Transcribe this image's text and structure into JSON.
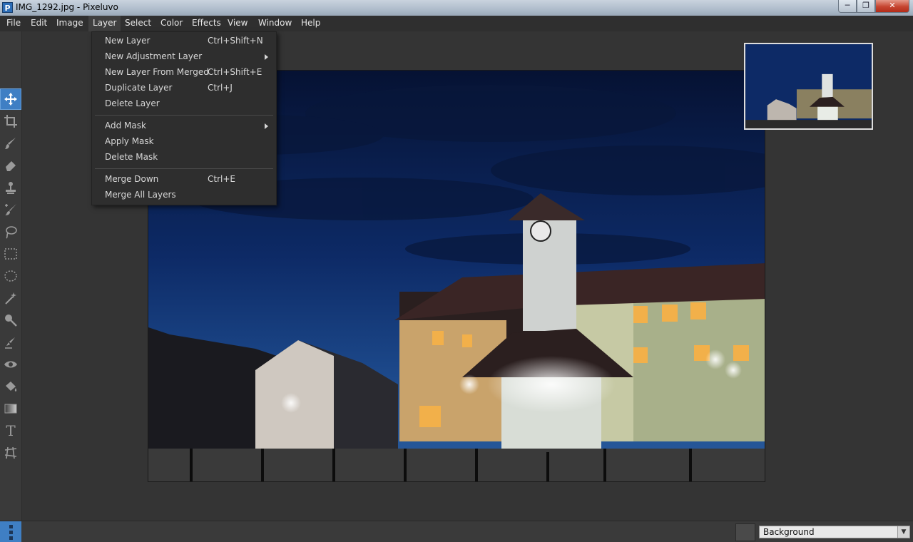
{
  "window": {
    "title": "IMG_1292.jpg - Pixeluvo",
    "app_icon_letter": "P"
  },
  "window_controls": {
    "minimize": "─",
    "maximize": "❐",
    "close": "✕"
  },
  "menubar": {
    "items": [
      {
        "label": "File"
      },
      {
        "label": "Edit"
      },
      {
        "label": "Image"
      },
      {
        "label": "Layer"
      },
      {
        "label": "Select"
      },
      {
        "label": "Color"
      },
      {
        "label": "Effects"
      },
      {
        "label": "View"
      },
      {
        "label": "Window"
      },
      {
        "label": "Help"
      }
    ]
  },
  "layer_menu": {
    "items": [
      {
        "label": "New Layer",
        "shortcut": "Ctrl+Shift+N"
      },
      {
        "label": "New Adjustment Layer",
        "shortcut": "",
        "submenu": true
      },
      {
        "label": "New Layer From Merged",
        "shortcut": "Ctrl+Shift+E"
      },
      {
        "label": "Duplicate Layer",
        "shortcut": "Ctrl+J"
      },
      {
        "label": "Delete Layer",
        "shortcut": ""
      },
      {
        "label": "Add Mask",
        "shortcut": "",
        "submenu": true
      },
      {
        "label": "Apply Mask",
        "shortcut": ""
      },
      {
        "label": "Delete Mask",
        "shortcut": ""
      },
      {
        "label": "Merge Down",
        "shortcut": "Ctrl+E"
      },
      {
        "label": "Merge All Layers",
        "shortcut": ""
      }
    ]
  },
  "toolbar": {
    "tools": [
      "move-icon",
      "crop-icon",
      "brush-icon",
      "eraser-icon",
      "clone-stamp-icon",
      "healing-icon",
      "lasso-icon",
      "rect-select-icon",
      "ellipse-select-icon",
      "magic-wand-icon",
      "dodge-icon",
      "smudge-icon",
      "red-eye-icon",
      "bucket-icon",
      "gradient-icon",
      "text-icon",
      "perspective-icon"
    ],
    "selected": "move-icon"
  },
  "text_tool_glyph": "T",
  "statusbar": {
    "layer_select_value": "Background",
    "chevron": "▼"
  },
  "colors": {
    "accent": "#3f7fc4",
    "background": "#343434",
    "menu_bg": "#2e2e2e"
  }
}
